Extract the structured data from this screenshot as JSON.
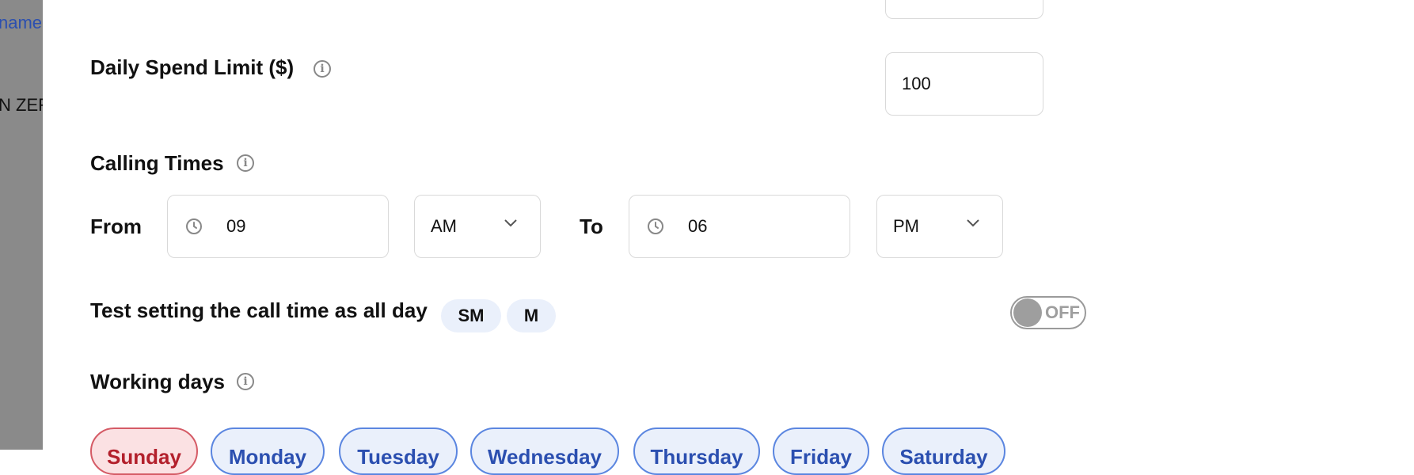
{
  "backdrop": {
    "link_fragment": "name",
    "text_fragment": "N ZEF"
  },
  "daily_spend": {
    "label": "Daily Spend Limit ($)",
    "value": "100"
  },
  "calling_times": {
    "label": "Calling Times",
    "from_label": "From",
    "from_hour": "09",
    "from_period": "AM",
    "to_label": "To",
    "to_hour": "06",
    "to_period": "PM"
  },
  "all_day": {
    "label": "Test setting the call time as all day",
    "chips": [
      "SM",
      "M"
    ],
    "toggle_text": "OFF",
    "toggle_on": false
  },
  "working_days": {
    "label": "Working days",
    "days": [
      "Sunday",
      "Monday",
      "Tuesday",
      "Wednesday",
      "Thursday",
      "Friday",
      "Saturday"
    ],
    "selected": [
      "Sunday"
    ]
  },
  "colors": {
    "selected_day": "#fbe1e3",
    "unselected_day": "#eaf0fb",
    "accent": "#2b4fb0",
    "toggle_off": "#9e9e9e"
  },
  "icons": [
    "info-icon",
    "clock-icon",
    "chevron-down-icon"
  ]
}
